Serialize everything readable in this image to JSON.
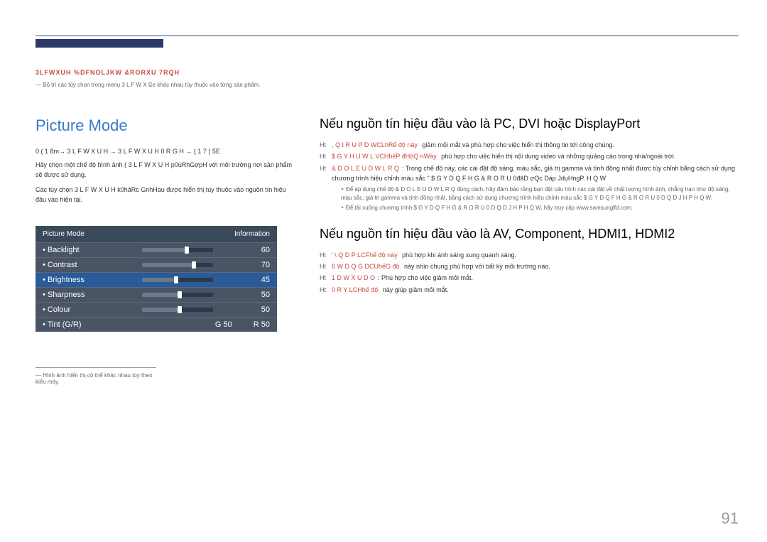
{
  "breadcrumb": "3LFWXUH %DFNOLJKW &RORXU 7RQH",
  "header_note": "― Bố trí các tùy chọn trong menu 3 L F W X ₢e khác nhau tùy thuộc vào từng sản phẩm.",
  "left": {
    "title": "Picture Mode",
    "path": "0 ( 1 8m→ 3 L F W X U H → 3 L F W X U H  0 R G H → ( 1 7 ( 5E",
    "desc1": "Hãy chọn một chế độ hình ảnh ( 3 L F W X U H p0ùRhGợpH với môi trường nơi sản phẩm sẽ được sử dụng.",
    "desc2": "Các tùy chọn 3 L F W X U H k0háRc GnhHau được hiển thị tùy thuộc vào nguồn tín hiệu đầu vào hiện tại.",
    "menu": {
      "header_left": "Picture Mode",
      "header_right": "Information",
      "rows": [
        {
          "label": "Backlight",
          "value": "60",
          "fill": 60
        },
        {
          "label": "Contrast",
          "value": "70",
          "fill": 70
        },
        {
          "label": "Brightness",
          "value": "45",
          "fill": 45,
          "active": true
        },
        {
          "label": "Sharpness",
          "value": "50",
          "fill": 50
        },
        {
          "label": "Colour",
          "value": "50",
          "fill": 50
        },
        {
          "label": "Tint (G/R)",
          "g": "G 50",
          "r": "R 50"
        }
      ]
    },
    "footer_note": "― Hình ảnh hiển thị có thể khác nhau tùy theo kiểu máy."
  },
  "right": {
    "section1": {
      "title": "Nếu nguồn tín hiệu đầu vào là PC, DVI hoặc DisplayPort",
      "items": [
        {
          "prefix": "Ht",
          "label": ", Q I R U P D WCLhRế độ này",
          "text": " giảm mỏi mắt và phù hợp cho việc hiển thị thông tin tới công chúng."
        },
        {
          "prefix": "Ht",
          "label": "$ G Y H U W L VCHhếP đHộQ nWày",
          "text": " phù hợp cho việc hiển thị nội dung video và những quảng cáo trong nhà/ngoài trời."
        },
        {
          "prefix": "Ht",
          "label": "& D O L E U D W L R Q",
          "text": ": Trong chế độ này, các cài đặt độ sáng, màu sắc, giá trị gamma và tính đồng nhất được tùy chỉnh bằng cách sử dụng chương trình hiệu chỉnh màu sắc \" $ G Y D Q F H G  & R O R U  0đăD ợQc Dáp JdụHngP. H Q W"
        }
      ],
      "sub1": "Để áp dụng chế độ & D O L E U D W L R Q đúng cách, hãy đảm bảo rằng bạn đặt cấu hình các cài đặt về chất lượng hình ảnh, chẳng hạn như độ sáng, màu sắc, giá trị gamma và tính đồng nhất, bằng cách sử dụng chương trình hiệu chỉnh màu sắc $ G Y D Q F H G  & R O R U  0 D Q D J H P H Q W.",
      "sub2": "Để tải xuống chương trình $ G Y D Q F H G  & R O R U  0 D Q D J H P H Q W, hãy truy cập www.samsunglfd.com."
    },
    "section2": {
      "title": "Nếu nguồn tín hiệu đầu vào là AV, Component, HDMI1, HDMI2",
      "items": [
        {
          "prefix": "Ht",
          "label": "' \\ Q D P LCFhế độ này",
          "text": " phù hợp khi ánh sáng xung quanh sáng."
        },
        {
          "prefix": "Ht",
          "label": "6 W D Q G DCUhếG độ",
          "text": " này nhìn chung phù hợp với bất kỳ môi trường nào."
        },
        {
          "prefix": "Ht",
          "label": "1 D W X U D O",
          "text": ": Phù hợp cho việc giảm mỏi mắt."
        },
        {
          "prefix": "Ht",
          "label": "0 R Y LCHhế độ",
          "text": " này giúp giảm mỏi mắt."
        }
      ]
    }
  },
  "page_number": "91"
}
